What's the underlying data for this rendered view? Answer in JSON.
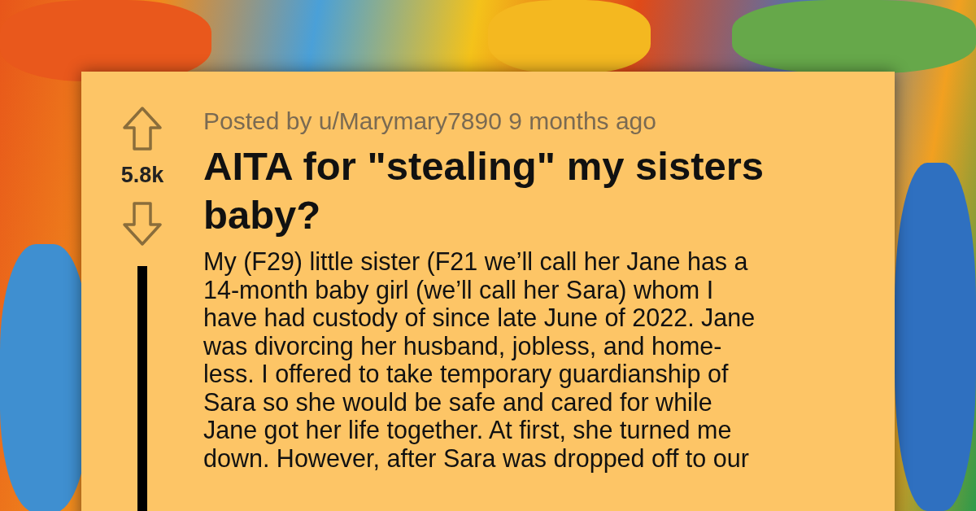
{
  "post": {
    "meta": "Posted by u/Marymary7890 9 months ago",
    "votes": "5.8k",
    "title": "AITA for \"stealing\" my sisters baby?",
    "body_lines": [
      "My (F29) little sister (F21 we’ll call her Jane has a",
      "14-month baby girl (we’ll call her Sara) whom I",
      "have had custody of since late June of 2022. Jane",
      "was divorcing her husband, jobless, and home-",
      "less. I offered to take temporary guardianship of",
      "Sara so she would be safe and cared for while",
      "Jane got her life together. At first, she turned me",
      "down. However, after Sara was dropped off to our"
    ]
  }
}
